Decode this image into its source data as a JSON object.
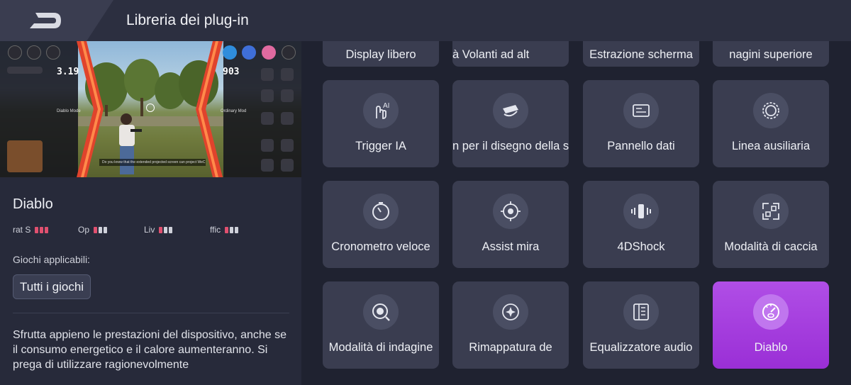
{
  "header": {
    "title": "Libreria dei plug-in"
  },
  "preview": {
    "cpu_value": "3.19",
    "fps_value": "903",
    "left_mode": "Diablo Mode",
    "right_mode": "Ordinary Mod",
    "caption": "Do you know that the extended projected screen can project WeC"
  },
  "plugin": {
    "name": "Diablo",
    "stats": [
      {
        "label": "rat  S",
        "level": 3
      },
      {
        "label": "Op",
        "level": 1
      },
      {
        "label": "Liv",
        "level": 1
      },
      {
        "label": "ffic",
        "level": 1
      }
    ],
    "games_label": "Giochi applicabili:",
    "games_chip": "Tutti i giochi",
    "description": "Sfrutta appieno le prestazioni del dispositivo, anche se il consumo energetico e il calore aumenteranno. Si prega di utilizzare ragionevolmente"
  },
  "grid": {
    "top_row": [
      "Display libero",
      "à          Volanti ad alt",
      "Estrazione scherma",
      "nagini superiore"
    ],
    "cards": [
      {
        "label": "Trigger IA",
        "icon": "ai-trigger-icon"
      },
      {
        "label": "n per il disegno della s",
        "icon": "drawing-icon"
      },
      {
        "label": "Pannello dati",
        "icon": "data-panel-icon"
      },
      {
        "label": "Linea ausiliaria",
        "icon": "auxiliary-line-icon"
      },
      {
        "label": "Cronometro veloce",
        "icon": "stopwatch-icon"
      },
      {
        "label": "Assist mira",
        "icon": "aim-assist-icon"
      },
      {
        "label": "4DShock",
        "icon": "vibration-icon"
      },
      {
        "label": "Modalità di caccia",
        "icon": "hunt-mode-icon"
      },
      {
        "label": "Modalità di indagine",
        "icon": "investigation-icon"
      },
      {
        "label": "Rimappatura de",
        "icon": "remap-icon"
      },
      {
        "label": "Equalizzatore audio",
        "icon": "equalizer-icon"
      },
      {
        "label": "Diablo",
        "icon": "diablo-speedometer-icon",
        "active": true
      }
    ]
  },
  "colors": {
    "accent": "#a33fe0",
    "stat_bar_on": "#e0506f",
    "stat_bar_off": "#cfd1da"
  }
}
